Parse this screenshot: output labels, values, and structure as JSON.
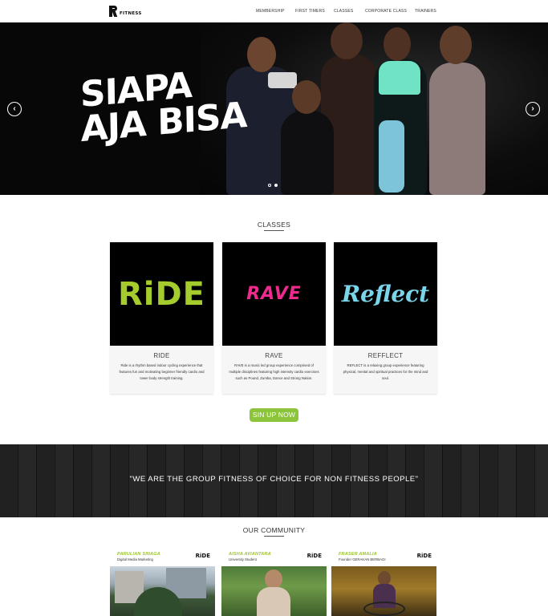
{
  "header": {
    "brand": "FITNESS",
    "nav": [
      "MEMBERSHIP",
      "FIRST TIMERS",
      "CLASSES",
      "CORPORATE CLASS",
      "TRAINERS"
    ]
  },
  "hero": {
    "headline": "SIAPA\nAJA BISA",
    "prev_icon": "chevron-left-icon",
    "next_icon": "chevron-right-icon",
    "slides": 2,
    "active_slide": 1
  },
  "classes": {
    "title": "CLASSES",
    "cards": [
      {
        "logo": "RiDE",
        "logo_color": "#a4cc2c",
        "name": "RIDE",
        "description": "Ride is a rhythm based indoor cycling experience that features fun and motivating beginner friendly cardio and tower body strength training."
      },
      {
        "logo": "RAVE",
        "logo_color": "#ee2a8c",
        "name": "RAVE",
        "description": "RAVE is a music led group experience comprised of multiple disciplines featuring high intensity cardio exercises such as Pound, Zumba, Dance and Strong Nation."
      },
      {
        "logo": "Reflect",
        "logo_color": "#7ad4ea",
        "name": "REFFLECT",
        "description": "REFLECT is a relaxing group experience featuring physical, mental and spiritual practices for the mind and soul."
      }
    ],
    "cta": "SIN UP NOW",
    "cta_color": "#8cc43c"
  },
  "quote": "\"WE ARE THE GROUP FITNESS OF CHOICE FOR NON FITNESS PEOPLE\"",
  "community": {
    "title": "OUR COMMUNITY",
    "members": [
      {
        "name": "PARULIAN SINAGA",
        "role": "Digital Media Marketing",
        "badge": "RiDE"
      },
      {
        "name": "AISHA AVIANTARA",
        "role": "University Student",
        "badge": "RiDE"
      },
      {
        "name": "FRASER AMALIA",
        "role": "Founder GERAKAN BERBAGI",
        "badge": "RiDE"
      }
    ]
  }
}
